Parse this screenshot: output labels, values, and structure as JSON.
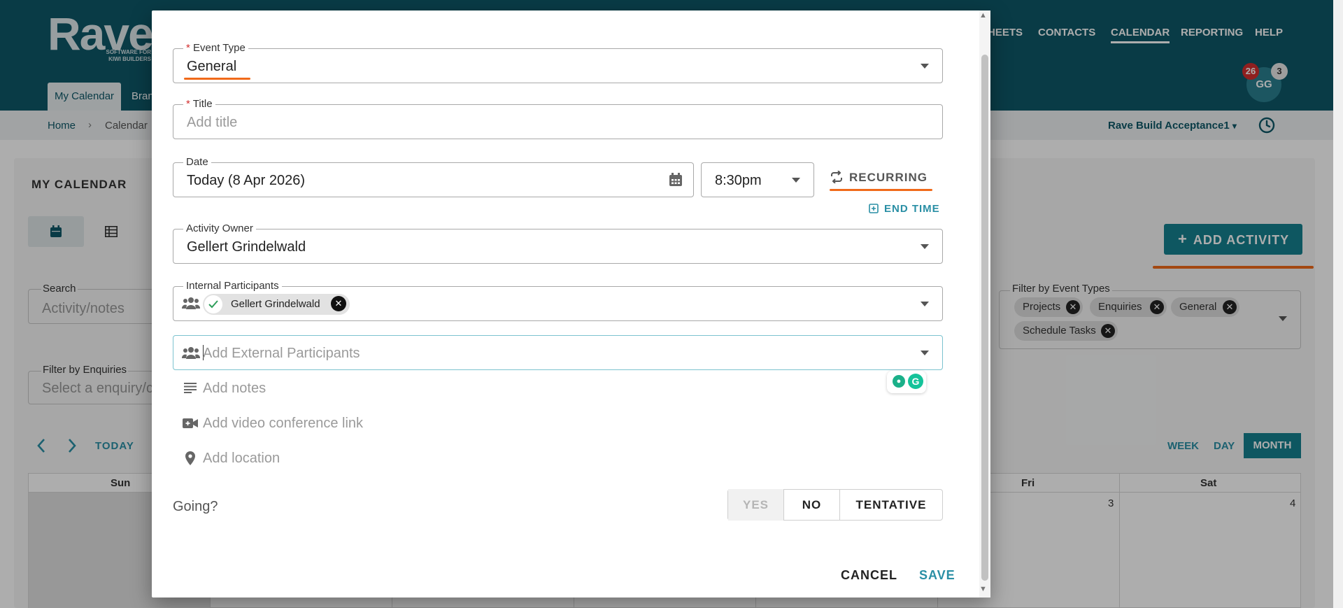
{
  "app": {
    "logo": "Rave",
    "logo_sub": "SOFTWARE FOR KIWI BUILDERS",
    "nav": [
      "HEETS",
      "CONTACTS",
      "CALENDAR",
      "REPORTING",
      "HELP"
    ],
    "tabs": [
      "My Calendar",
      "Bran"
    ],
    "avatar_initials": "GG",
    "badge_notifications": "26",
    "badge_messages": "3"
  },
  "breadcrumb": {
    "home": "Home",
    "separator": "›",
    "current": "Calendar"
  },
  "org_select": "Rave Build Acceptance1",
  "calendar": {
    "title": "MY CALENDAR",
    "search_label": "Search",
    "search_placeholder": "Activity/notes",
    "enquiries_label": "Filter by Enquiries",
    "enquiries_placeholder": "Select a enquiry/c",
    "today_label": "TODAY",
    "add_activity_label": "ADD ACTIVITY",
    "event_types_label": "Filter by Event Types",
    "event_types": [
      "Projects",
      "Enquiries",
      "General",
      "Schedule Tasks"
    ],
    "views": {
      "week": "WEEK",
      "day": "DAY",
      "month": "MONTH"
    },
    "day_headers": {
      "sun": "Sun",
      "fri": "Fri",
      "sat": "Sat"
    },
    "cell_numbers": {
      "fri": "3",
      "sat": "4"
    }
  },
  "modal": {
    "event_type_label": "Event Type",
    "event_type_value": "General",
    "title_label": "Title",
    "title_placeholder": "Add title",
    "date_label": "Date",
    "date_value": "Today (8 Apr 2026)",
    "time_value": "8:30pm",
    "recurring_label": "RECURRING",
    "end_time_label": "END TIME",
    "owner_label": "Activity Owner",
    "owner_value": "Gellert Grindelwald",
    "internal_label": "Internal Participants",
    "internal_chip": "Gellert Grindelwald",
    "external_placeholder": "Add External Participants",
    "notes_placeholder": "Add notes",
    "video_placeholder": "Add video conference link",
    "location_placeholder": "Add location",
    "going_label": "Going?",
    "going_yes": "YES",
    "going_no": "NO",
    "going_tentative": "TENTATIVE",
    "cancel_label": "CANCEL",
    "save_label": "SAVE",
    "required_mark": "*"
  },
  "colors": {
    "brand": "#0e5868",
    "accent": "#2a8fa5",
    "highlight": "#f06a1a",
    "required": "#d32f2f"
  }
}
